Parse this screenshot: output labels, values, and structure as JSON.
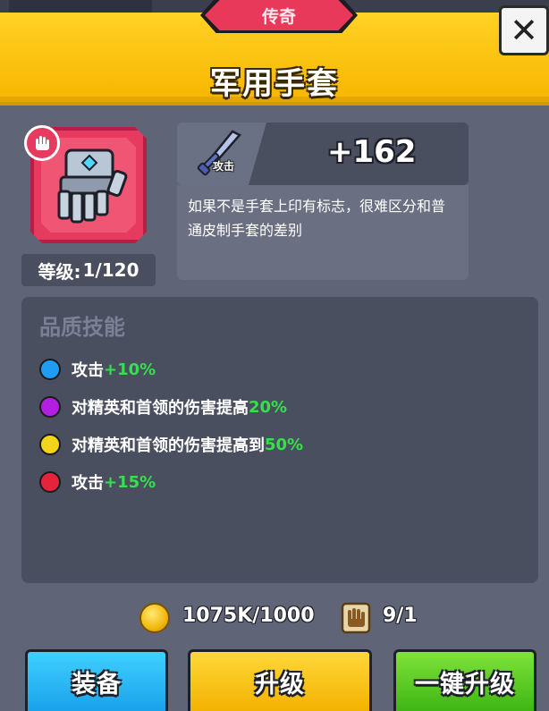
{
  "item": {
    "rarity": "传奇",
    "name": "军用手套",
    "level_label": "等级:",
    "level_value": "1/120",
    "stat_label": "攻击",
    "stat_value": "+162",
    "description": "如果不是手套上印有标志，很难区分和普通皮制手套的差别"
  },
  "skills": {
    "title": "品质技能",
    "items": [
      {
        "text": "攻击",
        "bonus": "+10%",
        "color": "#1e9df2"
      },
      {
        "text": "对精英和首领的伤害提高",
        "bonus": "20%",
        "color": "#b21fe0"
      },
      {
        "text": "对精英和首领的伤害提高到",
        "bonus": "50%",
        "color": "#f2d41a"
      },
      {
        "text": "攻击",
        "bonus": "+15%",
        "color": "#e5243b"
      }
    ]
  },
  "costs": {
    "gold": "1075K/1000",
    "scroll": "9/1"
  },
  "buttons": {
    "equip": "装备",
    "upgrade": "升级",
    "one_click_upgrade": "一键升级"
  },
  "icons": {
    "close": "close-icon",
    "slot": "hand-slot-icon",
    "item": "gauntlet-icon",
    "stat": "sword-icon",
    "gold": "gold-coin-icon",
    "scroll": "glove-scroll-icon"
  },
  "colors": {
    "legendary": "#e63a5e",
    "header": "#f7b500",
    "bonus": "#36e04c"
  }
}
